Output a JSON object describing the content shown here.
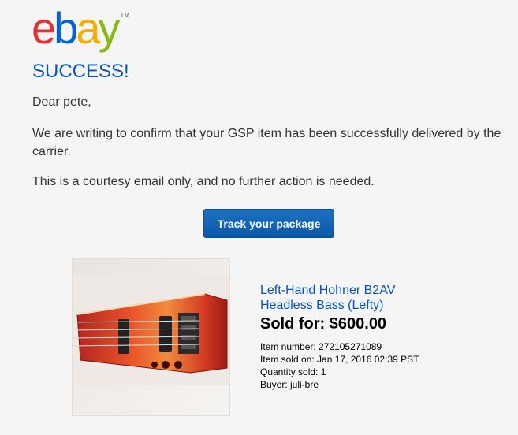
{
  "brand": {
    "letters": [
      "e",
      "b",
      "a",
      "y"
    ],
    "letter_colors": [
      "#e53238",
      "#0064d2",
      "#f5af02",
      "#86b817"
    ],
    "trademark": "TM"
  },
  "headline": "SUCCESS!",
  "greeting": "Dear pete,",
  "message_confirm": "We are writing to confirm that your GSP item has been successfully delivered by the carrier.",
  "message_courtesy": "This is a courtesy email only, and no further action is needed.",
  "track_button": "Track your package",
  "item": {
    "title": "Left-Hand Hohner B2AV Headless Bass (Lefty)",
    "sold_for": "Sold for: $600.00",
    "item_number": "Item number: 272105271089",
    "sold_on": "Item sold on: Jan 17, 2016 02:39 PST",
    "quantity": "Quantity sold: 1",
    "buyer": "Buyer: juli-bre",
    "image_icon": "bass-guitar-photo"
  },
  "colors": {
    "link": "#0654ba",
    "button": "#0b5aa8"
  }
}
